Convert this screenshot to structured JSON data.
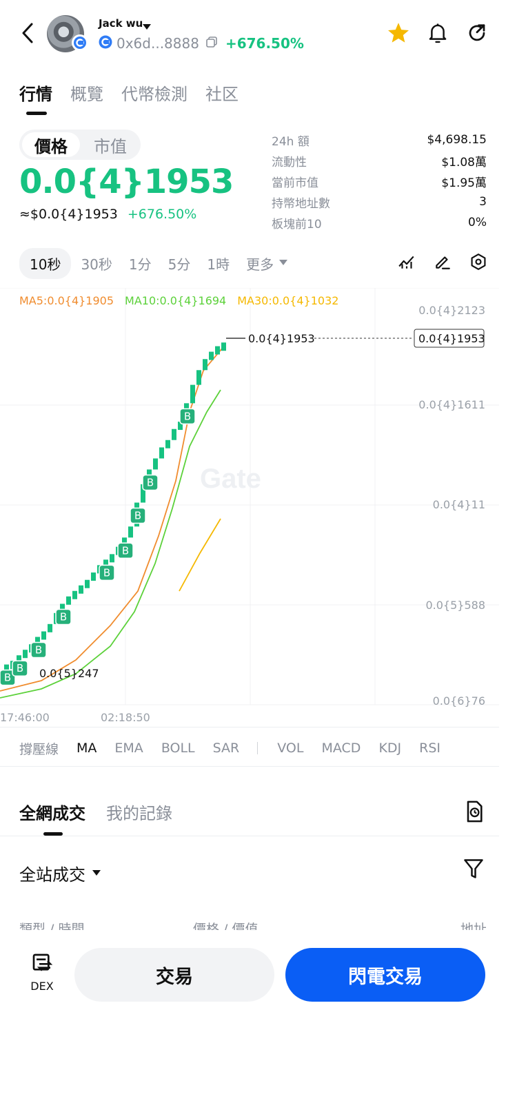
{
  "header": {
    "username": "Jack wu",
    "address": "0x6d...8888",
    "change_pct": "+676.50%",
    "colors": {
      "up": "#17c281",
      "star": "#f5b800"
    }
  },
  "main_tabs": [
    {
      "label": "行情",
      "active": true
    },
    {
      "label": "概覽",
      "active": false
    },
    {
      "label": "代幣檢測",
      "active": false
    },
    {
      "label": "社区",
      "active": false
    }
  ],
  "price_panel": {
    "segment": {
      "price": "價格",
      "market_cap": "市值"
    },
    "price": "0.0{4}1953",
    "usd_price": "≈$0.0{4}1953",
    "change_pct": "+676.50%",
    "stats": [
      {
        "label": "24h  額",
        "value": "$4,698.15"
      },
      {
        "label": "流動性",
        "value": "$1.08萬"
      },
      {
        "label": "當前市值",
        "value": "$1.95萬"
      },
      {
        "label": "持幣地址數",
        "value": "3"
      },
      {
        "label": "板塊前10",
        "value": "0%"
      }
    ]
  },
  "timeframes": {
    "items": [
      "10秒",
      "30秒",
      "1分",
      "5分",
      "1時"
    ],
    "active": "10秒",
    "more": "更多"
  },
  "chart_data": {
    "type": "candlestick",
    "ma_legend": [
      {
        "label": "MA5:0.0{4}1905",
        "color": "#f08c2e"
      },
      {
        "label": "MA10:0.0{4}1694",
        "color": "#5cd13a"
      },
      {
        "label": "MA30:0.0{4}1032",
        "color": "#f5b800"
      }
    ],
    "y_ticks": [
      "0.0{4}2123",
      "0.0{4}1611",
      "0.0{4}11",
      "0.0{5}588",
      "0.0{6}76"
    ],
    "x_ticks": [
      "17:46:00",
      "02:18:50"
    ],
    "last_price_label": "0.0{4}1953",
    "last_price_marker": "0.0{4}1953",
    "low_label": "0.0{5}247",
    "watermark": "Gate",
    "buy_marker": "B",
    "candles_close": [
      0.2,
      0.22,
      0.25,
      0.28,
      0.31,
      0.35,
      0.38,
      0.42,
      0.48,
      0.53,
      0.57,
      0.6,
      0.63,
      0.66,
      0.7,
      0.74,
      0.77,
      0.8,
      0.84,
      0.89,
      0.95,
      1.08,
      1.18,
      1.26,
      1.32,
      1.38,
      1.42,
      1.48,
      1.52,
      1.62,
      1.72,
      1.8,
      1.86,
      1.9,
      1.93,
      1.95
    ]
  },
  "indicators": {
    "items": [
      "撐壓線",
      "MA",
      "EMA",
      "BOLL",
      "SAR"
    ],
    "active": "MA",
    "sub_items": [
      "VOL",
      "MACD",
      "KDJ",
      "RSI"
    ]
  },
  "trades": {
    "tabs": [
      {
        "label": "全網成交",
        "active": true
      },
      {
        "label": "我的記錄",
        "active": false
      }
    ],
    "filter_label": "全站成交",
    "columns": [
      "類型 / 時間",
      "價格 / 價值",
      "地址"
    ]
  },
  "bottom": {
    "dex_label": "DEX",
    "trade_label": "交易",
    "flash_label": "閃電交易",
    "flash_color": "#0a5ef5"
  }
}
